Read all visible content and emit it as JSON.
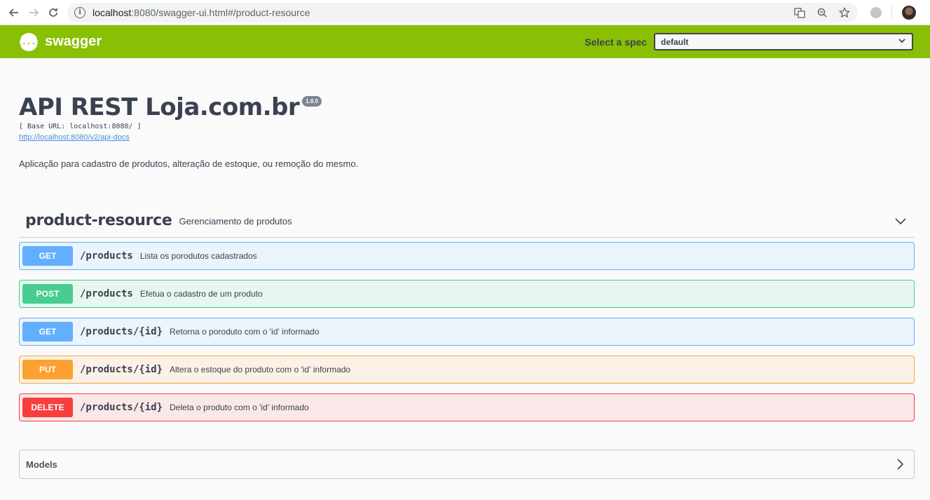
{
  "browser": {
    "url_host": "localhost",
    "url_path": ":8080/swagger-ui.html#/product-resource"
  },
  "topbar": {
    "logo_text": "swagger",
    "logo_glyph": "{...}",
    "spec_label": "Select a spec",
    "spec_value": "default",
    "bg_color": "#89bf04"
  },
  "info": {
    "title": "API REST Loja.com.br",
    "version": "1.0.0",
    "base_url": "[ Base URL: localhost:8080/ ]",
    "docs_link": "http://localhost:8080/v2/api-docs",
    "description": "Aplicação para cadastro de produtos, alteração de estoque, ou remoção do mesmo."
  },
  "tag": {
    "name": "product-resource",
    "description": "Gerenciamento de produtos"
  },
  "operations": [
    {
      "method": "GET",
      "path": "/products",
      "summary": "Lista os porodutos cadastrados",
      "color": "#61affe"
    },
    {
      "method": "POST",
      "path": "/products",
      "summary": "Efetua o cadastro de um produto",
      "color": "#49cc90"
    },
    {
      "method": "GET",
      "path": "/products/{id}",
      "summary": "Retorna o poroduto com o 'id' informado",
      "color": "#61affe"
    },
    {
      "method": "PUT",
      "path": "/products/{id}",
      "summary": "Altera o estoque do produto com o 'id' informado",
      "color": "#fca130"
    },
    {
      "method": "DELETE",
      "path": "/products/{id}",
      "summary": "Deleta o produto com o 'id' informado",
      "color": "#f93e3e"
    }
  ],
  "models": {
    "title": "Models"
  }
}
